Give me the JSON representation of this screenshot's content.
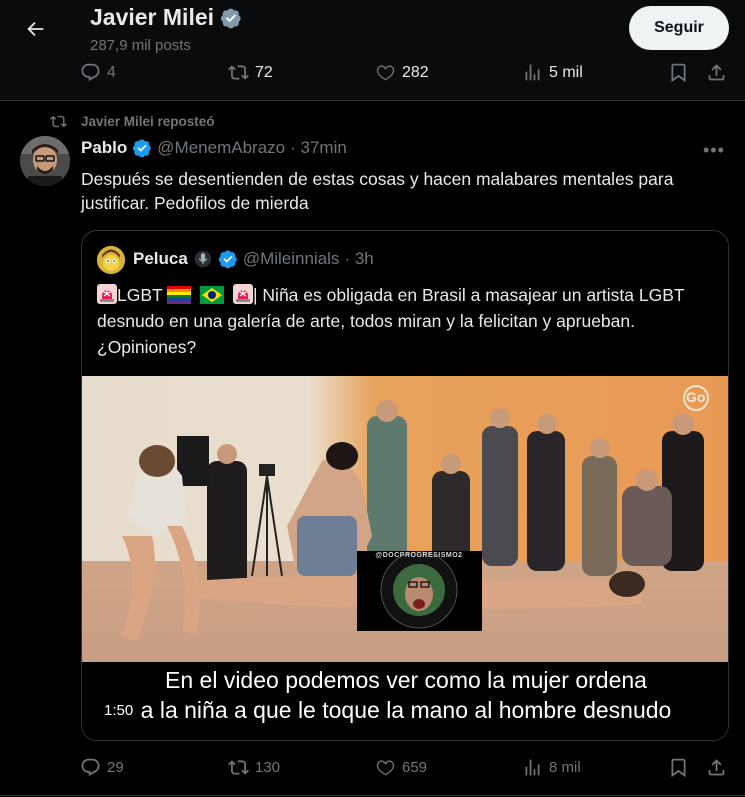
{
  "header": {
    "title": "Javier Milei",
    "posts_count": "287,9 mil posts",
    "follow_label": "Seguir"
  },
  "top_actions": {
    "replies": "4",
    "reposts": "72",
    "likes": "282",
    "views": "5 mil"
  },
  "tweet": {
    "repost_label": "Javier Milei reposteó",
    "author_name": "Pablo",
    "author_handle": "@MenemAbrazo",
    "time": "· 37min",
    "text": "Después se desentienden de estas cosas y hacen malabares mentales para justificar. Pedofilos de mierda",
    "quote": {
      "author_name": "Peluca",
      "author_handle": "@Mileinnials",
      "time": "· 3h",
      "text_lgbt": "LGBT",
      "text_body": "| Niña es obligada en Brasil a masajear un artista LGBT desnudo en una galería de arte, todos miran y la felicitan y aprueban. ¿Opiniones?",
      "video": {
        "caption_line1": "En el video podemos ver como la mujer ordena",
        "caption_line2": "a la niña a que le toque la mano al hombre desnudo",
        "duration": "1:50",
        "watermark": "Go",
        "badge_text": "@DOCPROGRESISMO2"
      }
    },
    "actions": {
      "replies": "29",
      "reposts": "130",
      "likes": "659",
      "views": "8 mil"
    }
  },
  "colors": {
    "background": "#000000",
    "text": "#e7e9ea",
    "muted": "#71767b",
    "verified": "#1d9bf0",
    "border": "#2f3336"
  }
}
